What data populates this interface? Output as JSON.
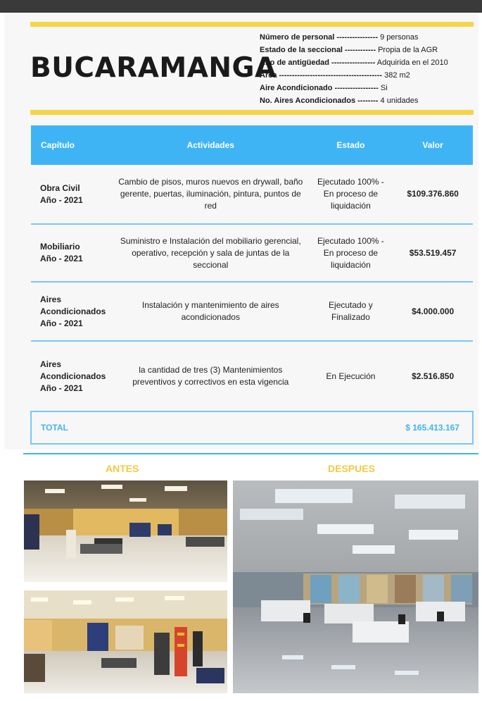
{
  "header": {
    "city": "BUCARAMANGA",
    "info": [
      {
        "label": "Número de personal ----------------",
        "value": "9 personas"
      },
      {
        "label": "Estado de la seccional ------------",
        "value": "Propia de la AGR"
      },
      {
        "label": "Año de antigüedad -----------------",
        "value": "Adquirida en el 2010"
      },
      {
        "label": "Área ----------------------------------------",
        "value": "382 m2"
      },
      {
        "label": "Aire Acondicionado -----------------",
        "value": "Si"
      },
      {
        "label": "No. Aires Acondicionados --------",
        "value": "4 unidades"
      }
    ]
  },
  "table": {
    "headers": [
      "Capítulo",
      "Actividades",
      "Estado",
      "Valor"
    ],
    "rows": [
      {
        "capitulo_1": "Obra Civil",
        "capitulo_2": "",
        "capitulo_3": "Año - 2021",
        "actividades": "Cambio de pisos, muros nuevos en drywall, baño gerente, puertas, iluminación, pintura, puntos de red",
        "estado": "Ejecutado 100% - En proceso de liquidación",
        "valor": "$109.376.860"
      },
      {
        "capitulo_1": "Mobiliario",
        "capitulo_2": "",
        "capitulo_3": "Año - 2021",
        "actividades": "Suministro e  Instalación del mobiliario gerencial, operativo, recepción y sala de juntas de la seccional",
        "estado": "Ejecutado 100% - En proceso de liquidación",
        "valor": "$53.519.457"
      },
      {
        "capitulo_1": "Aires",
        "capitulo_2": "Acondicionados",
        "capitulo_3": "Año - 2021",
        "actividades": "Instalación y mantenimiento de aires acondicionados",
        "estado": "Ejecutado y Finalizado",
        "valor": "$4.000.000"
      },
      {
        "capitulo_1": "Aires",
        "capitulo_2": "Acondicionados",
        "capitulo_3": "Año - 2021",
        "actividades": "la cantidad de tres (3) Mantenimientos preventivos y correctivos en esta vigencia",
        "estado": "En Ejecución",
        "valor": "$2.516.850"
      }
    ],
    "total_label": "TOTAL",
    "total_value": "$ 165.413.167"
  },
  "photos": {
    "before_label": "ANTES",
    "after_label": "DESPUES"
  },
  "colors": {
    "accent_yellow": "#f5d547",
    "header_blue": "#3fb4f5",
    "label_gold": "#f5c842"
  }
}
